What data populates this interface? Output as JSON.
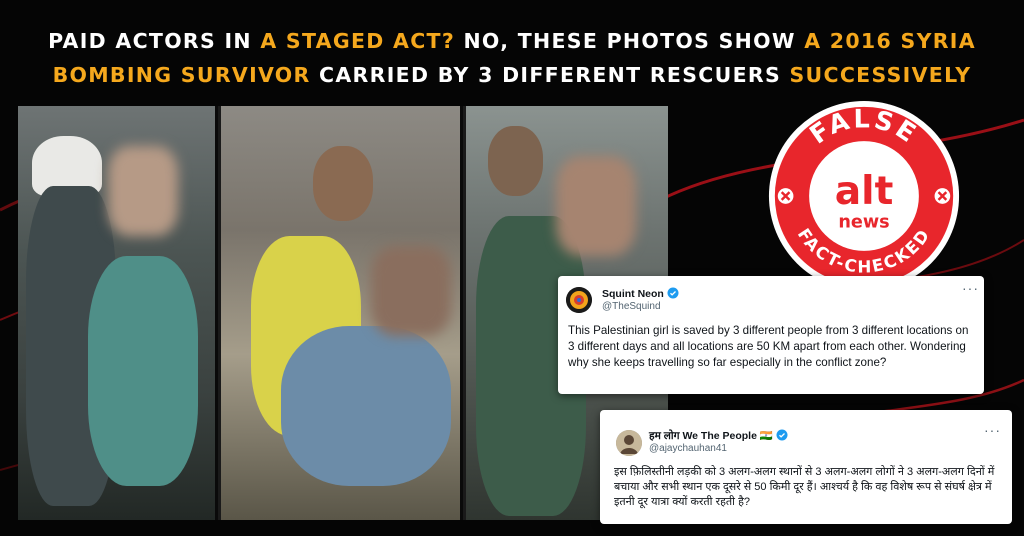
{
  "headline": {
    "line1": [
      {
        "text": "Paid actors in ",
        "accent": false
      },
      {
        "text": "a staged act?",
        "accent": true
      },
      {
        "text": " No, these photos show ",
        "accent": false
      },
      {
        "text": "a 2016 Syria",
        "accent": true
      }
    ],
    "line2": [
      {
        "text": "bombing survivor",
        "accent": true
      },
      {
        "text": " carried by 3 different rescuers ",
        "accent": false
      },
      {
        "text": "successively",
        "accent": true
      }
    ]
  },
  "stamp": {
    "top_text": "FALSE",
    "bottom_text": "FACT-CHECKED",
    "logo_alt": "alt",
    "logo_news": "news"
  },
  "tweets": [
    {
      "name": "Squint Neon",
      "handle": "@TheSquind",
      "text": "This Palestinian girl is saved by 3 different people from 3 different locations on 3 different days and all locations are 50 KM apart from each other. Wondering why she keeps travelling so far especially in the conflict zone?",
      "more": "···"
    },
    {
      "name": "हम लोग We The People 🇮🇳",
      "handle": "@ajaychauhan41",
      "text": "इस फ़िलिस्तीनी लड़की को 3 अलग-अलग स्थानों से 3 अलग-अलग लोगों ने 3 अलग-अलग दिनों में बचाया और सभी स्थान एक दूसरे से 50 किमी दूर हैं। आश्चर्य है कि वह विशेष रूप से संघर्ष क्षेत्र में इतनी दूर यात्रा क्यों करती रहती है?",
      "more": "···"
    }
  ],
  "colors": {
    "accent": "#f5a81d",
    "stamp_red": "#e8262c",
    "background": "#050505",
    "verified": "#1d9bf0"
  }
}
